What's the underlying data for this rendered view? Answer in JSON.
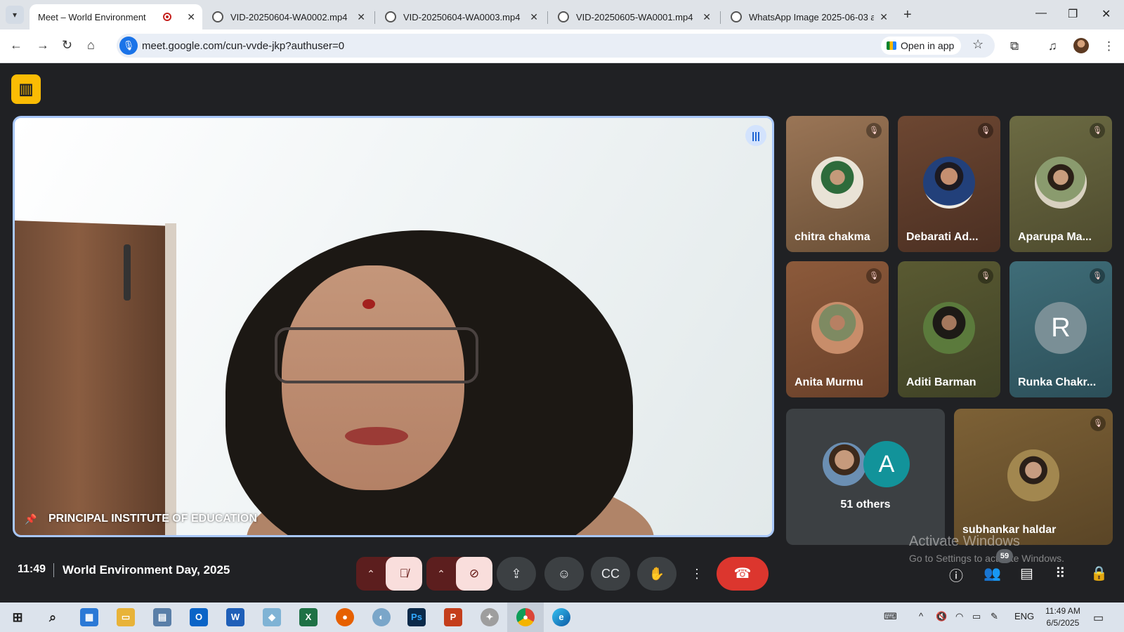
{
  "browser": {
    "tabs": [
      {
        "title": "Meet – World Environment",
        "active": true
      },
      {
        "title": "VID-20250604-WA0002.mp4",
        "active": false
      },
      {
        "title": "VID-20250604-WA0003.mp4",
        "active": false
      },
      {
        "title": "VID-20250605-WA0001.mp4",
        "active": false
      },
      {
        "title": "WhatsApp Image 2025-06-03 a",
        "active": false
      }
    ],
    "url": "meet.google.com/cun-vvde-jkp?authuser=0",
    "open_in_app": "Open in app"
  },
  "meet": {
    "main_speaker": "PRINCIPAL INSTITUTE OF EDUCATION",
    "participants": [
      {
        "name": "chitra chakma"
      },
      {
        "name": "Debarati Ad..."
      },
      {
        "name": "Aparupa Ma..."
      },
      {
        "name": "Anita Murmu"
      },
      {
        "name": "Aditi Barman"
      },
      {
        "name": "Runka Chakr...",
        "initial": "R"
      },
      {
        "name": "subhankar haldar"
      }
    ],
    "others": {
      "initial": "A",
      "label": "51 others"
    },
    "clock": "11:49",
    "meeting_title": "World Environment Day, 2025",
    "people_count": "59"
  },
  "watermark": {
    "line1": "Activate Windows",
    "line2": "Go to Settings to activate Windows."
  },
  "taskbar": {
    "lang": "ENG",
    "time": "11:49 AM",
    "date": "6/5/2025",
    "apps": [
      "O",
      "W",
      "X",
      "Ps",
      "P"
    ]
  },
  "colors": {
    "meet_bg": "#202124",
    "speaker_border": "#a8c7fa",
    "end_call": "#dc362e",
    "muted_button": "#f9dedc"
  }
}
